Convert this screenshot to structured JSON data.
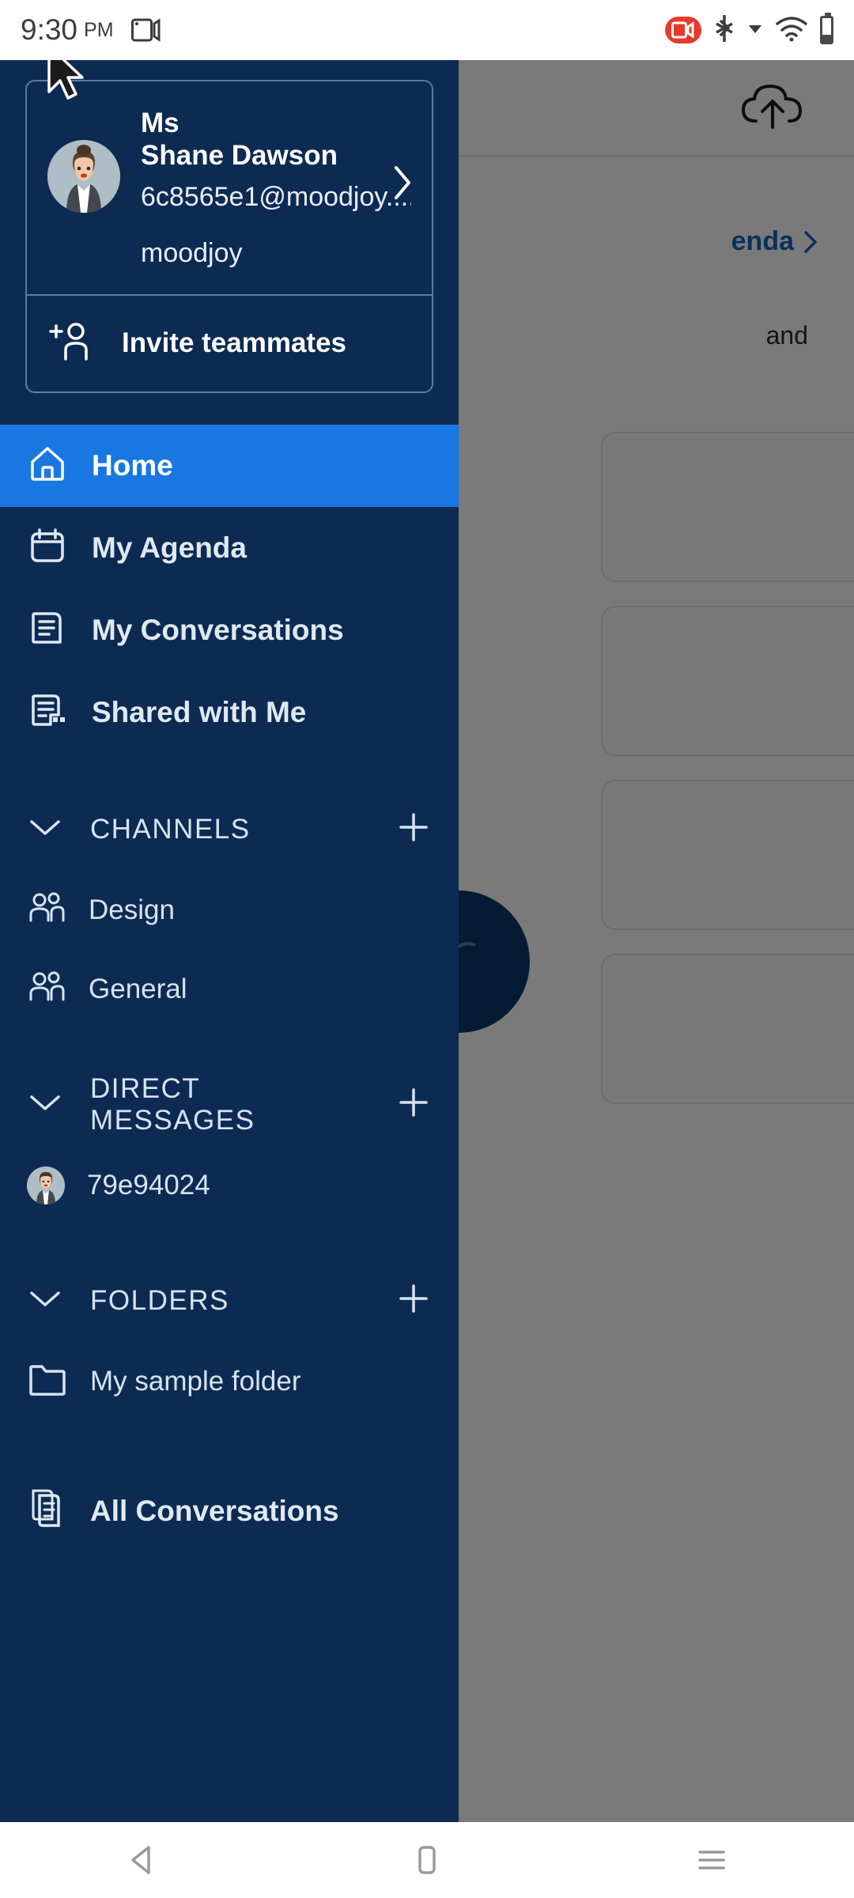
{
  "status_bar": {
    "time": "9:30",
    "ampm": "PM",
    "icons": {
      "cast": "cast-screen-icon",
      "recording": "screen-recording-icon",
      "bluetooth": "bluetooth-icon",
      "dropdown": "dropdown-arrow-icon",
      "wifi": "wifi-icon",
      "battery": "battery-icon"
    }
  },
  "drawer": {
    "profile": {
      "title": "Ms",
      "name": "Shane Dawson",
      "email": "6c8565e1@moodjoy....",
      "workspace": "moodjoy",
      "chevron": "chevron-right-icon",
      "avatar": "user-avatar"
    },
    "invite": {
      "label": "Invite teammates",
      "icon": "add-person-icon"
    },
    "nav_items": [
      {
        "label": "Home",
        "icon": "home-icon",
        "active": true
      },
      {
        "label": "My Agenda",
        "icon": "calendar-icon",
        "active": false
      },
      {
        "label": "My Conversations",
        "icon": "conversations-icon",
        "active": false
      },
      {
        "label": "Shared with Me",
        "icon": "shared-document-icon",
        "active": false
      }
    ],
    "sections": [
      {
        "title": "CHANNELS",
        "collapse_icon": "chevron-down-icon",
        "add_icon": "plus-icon",
        "items": [
          {
            "label": "Design",
            "icon": "people-icon"
          },
          {
            "label": "General",
            "icon": "people-icon"
          }
        ]
      },
      {
        "title": "DIRECT MESSAGES",
        "collapse_icon": "chevron-down-icon",
        "add_icon": "plus-icon",
        "items": [
          {
            "label": "79e94024",
            "icon": "user-avatar"
          }
        ]
      },
      {
        "title": "FOLDERS",
        "collapse_icon": "chevron-down-icon",
        "add_icon": "plus-icon",
        "items": [
          {
            "label": "My sample folder",
            "icon": "folder-icon"
          }
        ]
      }
    ],
    "footer": {
      "label": "All Conversations",
      "icon": "all-conversations-icon"
    }
  },
  "background": {
    "upload_icon": "cloud-upload-icon",
    "agenda_link": "enda",
    "agenda_chevron": "chevron-right-icon",
    "snippet_text": "and",
    "fab_icon": "compose-icon"
  },
  "nav_bar": {
    "back": "back-triangle-icon",
    "home": "home-square-icon",
    "recents": "recents-menu-icon"
  },
  "colors": {
    "drawer_bg": "#0d2b52",
    "active_item": "#1877e0",
    "accent_link": "#1565c0",
    "record_red": "#e8392a"
  }
}
